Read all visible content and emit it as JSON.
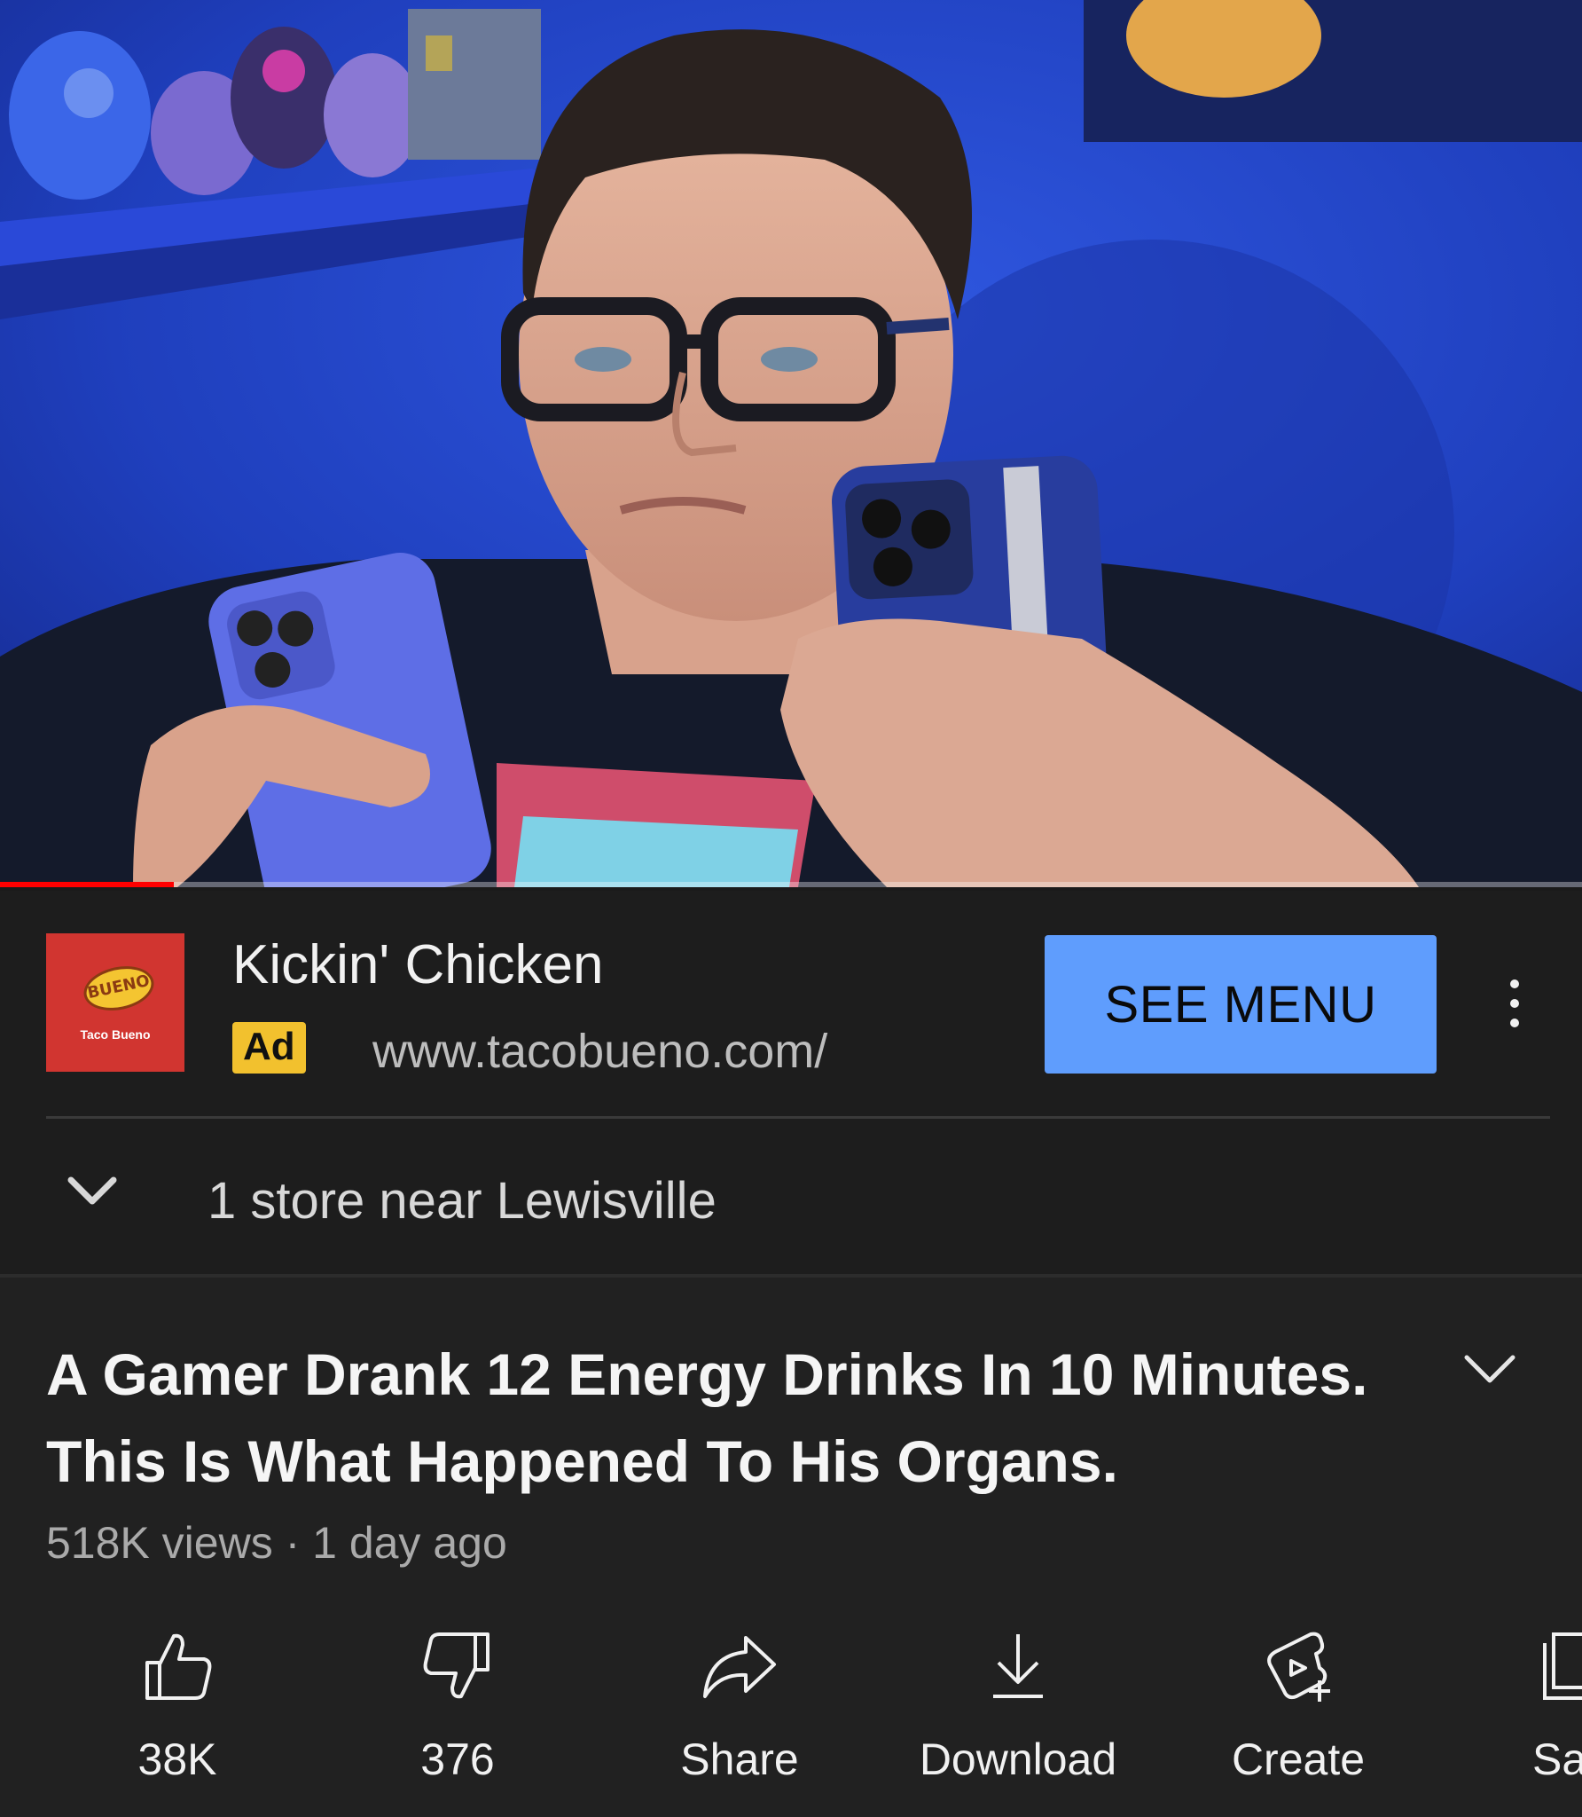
{
  "player": {
    "progress_fraction": 0.11
  },
  "ad": {
    "logo_bubble_text": "BUENO",
    "logo_brand_text": "Taco Bueno",
    "title": "Kickin' Chicken",
    "badge": "Ad",
    "url": "www.tacobueno.com/",
    "cta_label": "SEE MENU",
    "store_text": "1 store near Lewisville",
    "logo_color": "#d13530",
    "cta_color": "#5f9dfd",
    "badge_color": "#f2c12e"
  },
  "video": {
    "title": "A Gamer Drank 12 Energy Drinks In 10 Minutes. This Is What Happened To His Organs.",
    "meta": "518K views · 1 day ago"
  },
  "actions": [
    {
      "icon": "thumbs-up-icon",
      "label": "38K"
    },
    {
      "icon": "thumbs-down-icon",
      "label": "376"
    },
    {
      "icon": "share-icon",
      "label": "Share"
    },
    {
      "icon": "download-icon",
      "label": "Download"
    },
    {
      "icon": "create-icon",
      "label": "Create"
    },
    {
      "icon": "save-icon",
      "label": "Sa"
    }
  ]
}
